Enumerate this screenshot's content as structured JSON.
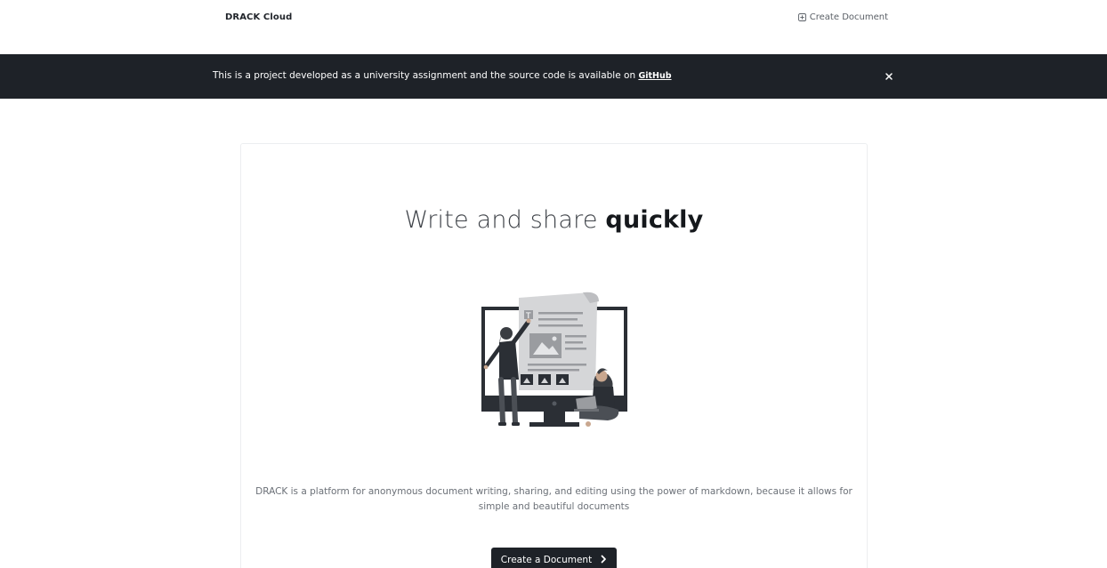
{
  "nav": {
    "brand": "DRACK Cloud",
    "create_label": "Create Document"
  },
  "banner": {
    "text": "This is a project developed as a university assignment and the source code is available on ",
    "link_label": "GitHub"
  },
  "hero": {
    "title_light": "Write and share ",
    "title_bold": "quickly",
    "description": "DRACK is a platform for anonymous document writing, sharing, and editing using the power of markdown, because it allows for simple and beautiful documents",
    "cta_label": "Create a Document"
  },
  "colors": {
    "dark": "#1e2228",
    "text_muted": "#6b7077",
    "border": "#eceef0"
  },
  "icons": {
    "nav_create": "plus-square-icon",
    "banner_close": "close-icon",
    "cta": "chevron-right-icon"
  }
}
